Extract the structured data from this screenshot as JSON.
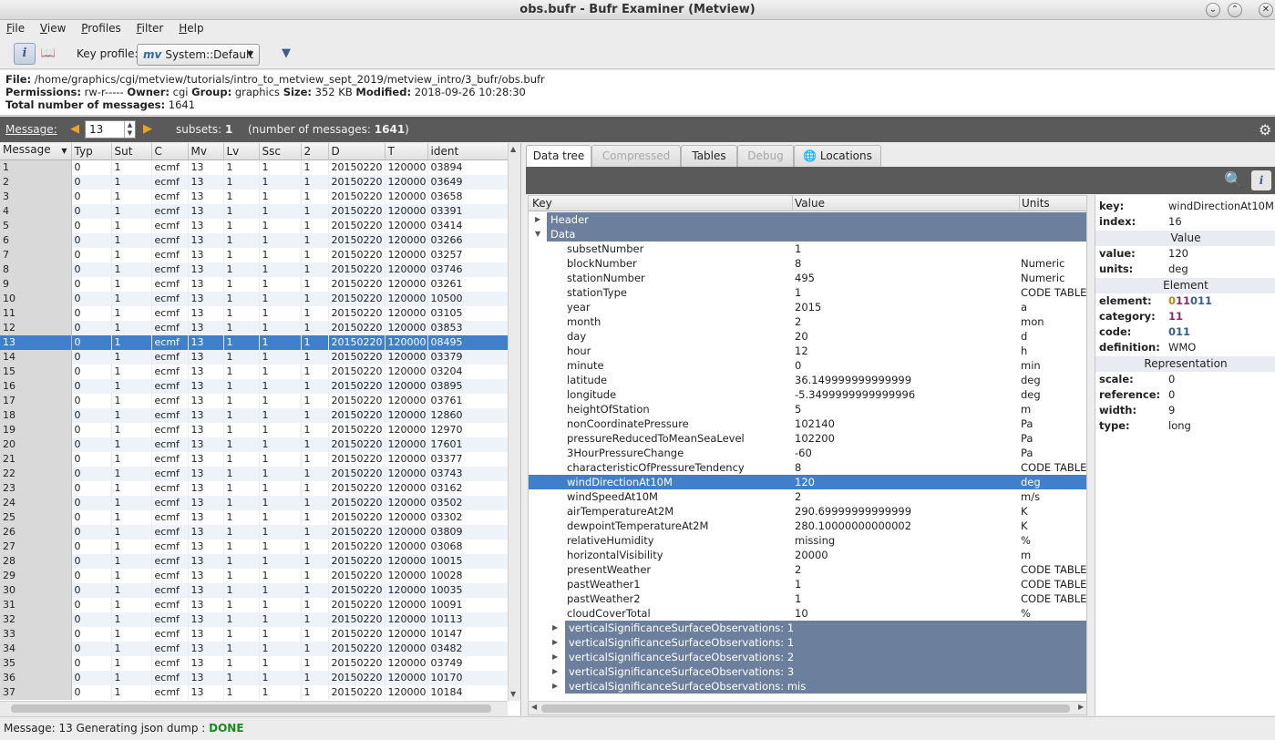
{
  "window": {
    "title": "obs.bufr - Bufr Examiner (Metview)"
  },
  "menu": [
    "File",
    "View",
    "Profiles",
    "Filter",
    "Help"
  ],
  "toolbar": {
    "key_profile_label": "Key profile:",
    "key_profile_value": "System::Default",
    "key_profile_logo": "mv"
  },
  "file_info": {
    "file_label": "File:",
    "file": "/home/graphics/cgi/metview/tutorials/intro_to_metview_sept_2019/metview_intro/3_bufr/obs.bufr",
    "perm_label": "Permissions:",
    "perm": "rw-r-----",
    "owner_label": "Owner:",
    "owner": "cgi",
    "group_label": "Group:",
    "group": "graphics",
    "size_label": "Size:",
    "size": "352 KB",
    "modified_label": "Modified:",
    "modified": "2018-09-26 10:28:30",
    "total_label": "Total number of messages:",
    "total": "1641"
  },
  "message_bar": {
    "label": "Message:",
    "current": "13",
    "subsets_label": "subsets:",
    "subsets": "1",
    "num_prefix": "(number of messages:",
    "num": "1641",
    "num_suffix": ")"
  },
  "msg_table": {
    "columns": [
      "Message",
      "Typ",
      "Sut",
      "C",
      "Mv",
      "Lv",
      "Ssc",
      "2",
      "D",
      "T",
      "ident"
    ],
    "rows": [
      [
        "1",
        "0",
        "1",
        "ecmf",
        "13",
        "1",
        "1",
        "1",
        "20150220",
        "120000",
        "03894"
      ],
      [
        "2",
        "0",
        "1",
        "ecmf",
        "13",
        "1",
        "1",
        "1",
        "20150220",
        "120000",
        "03649"
      ],
      [
        "3",
        "0",
        "1",
        "ecmf",
        "13",
        "1",
        "1",
        "1",
        "20150220",
        "120000",
        "03658"
      ],
      [
        "4",
        "0",
        "1",
        "ecmf",
        "13",
        "1",
        "1",
        "1",
        "20150220",
        "120000",
        "03391"
      ],
      [
        "5",
        "0",
        "1",
        "ecmf",
        "13",
        "1",
        "1",
        "1",
        "20150220",
        "120000",
        "03414"
      ],
      [
        "6",
        "0",
        "1",
        "ecmf",
        "13",
        "1",
        "1",
        "1",
        "20150220",
        "120000",
        "03266"
      ],
      [
        "7",
        "0",
        "1",
        "ecmf",
        "13",
        "1",
        "1",
        "1",
        "20150220",
        "120000",
        "03257"
      ],
      [
        "8",
        "0",
        "1",
        "ecmf",
        "13",
        "1",
        "1",
        "1",
        "20150220",
        "120000",
        "03746"
      ],
      [
        "9",
        "0",
        "1",
        "ecmf",
        "13",
        "1",
        "1",
        "1",
        "20150220",
        "120000",
        "03261"
      ],
      [
        "10",
        "0",
        "1",
        "ecmf",
        "13",
        "1",
        "1",
        "1",
        "20150220",
        "120000",
        "10500"
      ],
      [
        "11",
        "0",
        "1",
        "ecmf",
        "13",
        "1",
        "1",
        "1",
        "20150220",
        "120000",
        "03105"
      ],
      [
        "12",
        "0",
        "1",
        "ecmf",
        "13",
        "1",
        "1",
        "1",
        "20150220",
        "120000",
        "03853"
      ],
      [
        "13",
        "0",
        "1",
        "ecmf",
        "13",
        "1",
        "1",
        "1",
        "20150220",
        "120000",
        "08495"
      ],
      [
        "14",
        "0",
        "1",
        "ecmf",
        "13",
        "1",
        "1",
        "1",
        "20150220",
        "120000",
        "03379"
      ],
      [
        "15",
        "0",
        "1",
        "ecmf",
        "13",
        "1",
        "1",
        "1",
        "20150220",
        "120000",
        "03204"
      ],
      [
        "16",
        "0",
        "1",
        "ecmf",
        "13",
        "1",
        "1",
        "1",
        "20150220",
        "120000",
        "03895"
      ],
      [
        "17",
        "0",
        "1",
        "ecmf",
        "13",
        "1",
        "1",
        "1",
        "20150220",
        "120000",
        "03761"
      ],
      [
        "18",
        "0",
        "1",
        "ecmf",
        "13",
        "1",
        "1",
        "1",
        "20150220",
        "120000",
        "12860"
      ],
      [
        "19",
        "0",
        "1",
        "ecmf",
        "13",
        "1",
        "1",
        "1",
        "20150220",
        "120000",
        "12970"
      ],
      [
        "20",
        "0",
        "1",
        "ecmf",
        "13",
        "1",
        "1",
        "1",
        "20150220",
        "120000",
        "17601"
      ],
      [
        "21",
        "0",
        "1",
        "ecmf",
        "13",
        "1",
        "1",
        "1",
        "20150220",
        "120000",
        "03377"
      ],
      [
        "22",
        "0",
        "1",
        "ecmf",
        "13",
        "1",
        "1",
        "1",
        "20150220",
        "120000",
        "03743"
      ],
      [
        "23",
        "0",
        "1",
        "ecmf",
        "13",
        "1",
        "1",
        "1",
        "20150220",
        "120000",
        "03162"
      ],
      [
        "24",
        "0",
        "1",
        "ecmf",
        "13",
        "1",
        "1",
        "1",
        "20150220",
        "120000",
        "03502"
      ],
      [
        "25",
        "0",
        "1",
        "ecmf",
        "13",
        "1",
        "1",
        "1",
        "20150220",
        "120000",
        "03302"
      ],
      [
        "26",
        "0",
        "1",
        "ecmf",
        "13",
        "1",
        "1",
        "1",
        "20150220",
        "120000",
        "03809"
      ],
      [
        "27",
        "0",
        "1",
        "ecmf",
        "13",
        "1",
        "1",
        "1",
        "20150220",
        "120000",
        "03068"
      ],
      [
        "28",
        "0",
        "1",
        "ecmf",
        "13",
        "1",
        "1",
        "1",
        "20150220",
        "120000",
        "10015"
      ],
      [
        "29",
        "0",
        "1",
        "ecmf",
        "13",
        "1",
        "1",
        "1",
        "20150220",
        "120000",
        "10028"
      ],
      [
        "30",
        "0",
        "1",
        "ecmf",
        "13",
        "1",
        "1",
        "1",
        "20150220",
        "120000",
        "10035"
      ],
      [
        "31",
        "0",
        "1",
        "ecmf",
        "13",
        "1",
        "1",
        "1",
        "20150220",
        "120000",
        "10091"
      ],
      [
        "32",
        "0",
        "1",
        "ecmf",
        "13",
        "1",
        "1",
        "1",
        "20150220",
        "120000",
        "10113"
      ],
      [
        "33",
        "0",
        "1",
        "ecmf",
        "13",
        "1",
        "1",
        "1",
        "20150220",
        "120000",
        "10147"
      ],
      [
        "34",
        "0",
        "1",
        "ecmf",
        "13",
        "1",
        "1",
        "1",
        "20150220",
        "120000",
        "03482"
      ],
      [
        "35",
        "0",
        "1",
        "ecmf",
        "13",
        "1",
        "1",
        "1",
        "20150220",
        "120000",
        "03749"
      ],
      [
        "36",
        "0",
        "1",
        "ecmf",
        "13",
        "1",
        "1",
        "1",
        "20150220",
        "120000",
        "10170"
      ],
      [
        "37",
        "0",
        "1",
        "ecmf",
        "13",
        "1",
        "1",
        "1",
        "20150220",
        "120000",
        "10184"
      ]
    ],
    "selected": "13"
  },
  "tabs": [
    {
      "label": "Data tree",
      "state": "active"
    },
    {
      "label": "Compressed",
      "state": "disabled"
    },
    {
      "label": "Tables",
      "state": "normal"
    },
    {
      "label": "Debug",
      "state": "disabled"
    },
    {
      "label": "Locations",
      "state": "normal",
      "icon": "globe-icon"
    }
  ],
  "tree": {
    "columns": {
      "key": "Key",
      "value": "Value",
      "units": "Units"
    },
    "header_group": "Header",
    "data_group": "Data",
    "rows": [
      {
        "key": "subsetNumber",
        "value": "1",
        "units": ""
      },
      {
        "key": "blockNumber",
        "value": "8",
        "units": "Numeric"
      },
      {
        "key": "stationNumber",
        "value": "495",
        "units": "Numeric"
      },
      {
        "key": "stationType",
        "value": "1",
        "units": "CODE TABLE"
      },
      {
        "key": "year",
        "value": "2015",
        "units": "a"
      },
      {
        "key": "month",
        "value": "2",
        "units": "mon"
      },
      {
        "key": "day",
        "value": "20",
        "units": "d"
      },
      {
        "key": "hour",
        "value": "12",
        "units": "h"
      },
      {
        "key": "minute",
        "value": "0",
        "units": "min"
      },
      {
        "key": "latitude",
        "value": "36.149999999999999",
        "units": "deg"
      },
      {
        "key": "longitude",
        "value": "-5.3499999999999996",
        "units": "deg"
      },
      {
        "key": "heightOfStation",
        "value": "5",
        "units": "m"
      },
      {
        "key": "nonCoordinatePressure",
        "value": "102140",
        "units": "Pa"
      },
      {
        "key": "pressureReducedToMeanSeaLevel",
        "value": "102200",
        "units": "Pa"
      },
      {
        "key": "3HourPressureChange",
        "value": "-60",
        "units": "Pa"
      },
      {
        "key": "characteristicOfPressureTendency",
        "value": "8",
        "units": "CODE TABLE"
      },
      {
        "key": "windDirectionAt10M",
        "value": "120",
        "units": "deg",
        "selected": true
      },
      {
        "key": "windSpeedAt10M",
        "value": "2",
        "units": "m/s"
      },
      {
        "key": "airTemperatureAt2M",
        "value": "290.69999999999999",
        "units": "K"
      },
      {
        "key": "dewpointTemperatureAt2M",
        "value": "280.10000000000002",
        "units": "K"
      },
      {
        "key": "relativeHumidity",
        "value": "missing",
        "units": "%"
      },
      {
        "key": "horizontalVisibility",
        "value": "20000",
        "units": "m"
      },
      {
        "key": "presentWeather",
        "value": "2",
        "units": "CODE TABLE"
      },
      {
        "key": "pastWeather1",
        "value": "1",
        "units": "CODE TABLE"
      },
      {
        "key": "pastWeather2",
        "value": "1",
        "units": "CODE TABLE"
      },
      {
        "key": "cloudCoverTotal",
        "value": "10",
        "units": "%"
      }
    ],
    "subgroups": [
      "verticalSignificanceSurfaceObservations: 1",
      "verticalSignificanceSurfaceObservations: 1",
      "verticalSignificanceSurfaceObservations: 2",
      "verticalSignificanceSurfaceObservations: 3",
      "verticalSignificanceSurfaceObservations: mis"
    ]
  },
  "details": {
    "key_label": "key:",
    "key": "windDirectionAt10M",
    "index_label": "index:",
    "index": "16",
    "value_section": "Value",
    "value_label": "value:",
    "value": "120",
    "units_label": "units:",
    "units": "deg",
    "element_section": "Element",
    "element_label": "element:",
    "element_a": "0",
    "element_b": "11",
    "element_c": "011",
    "category_label": "category:",
    "category": "11",
    "code_label": "code:",
    "code": "011",
    "definition_label": "definition:",
    "definition": "WMO",
    "repr_section": "Representation",
    "scale_label": "scale:",
    "scale": "0",
    "reference_label": "reference:",
    "reference": "0",
    "width_label": "width:",
    "width": "9",
    "type_label": "type:",
    "type": "long"
  },
  "status": {
    "prefix": "Message: 13 Generating json dump :",
    "result": "DONE"
  }
}
